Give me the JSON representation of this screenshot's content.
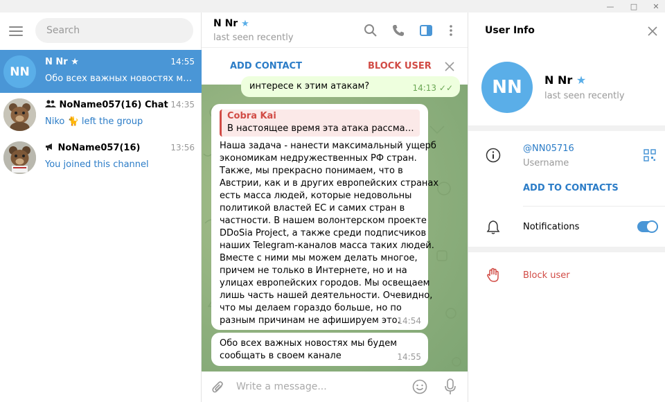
{
  "search": {
    "placeholder": "Search"
  },
  "dialogs": [
    {
      "name": "N Nr",
      "avatar_initials": "NN",
      "time": "14:55",
      "last_message": "Обо всех важных новостях мы б...",
      "starred": true
    },
    {
      "name": "NoName057(16) Chat",
      "time": "14:35",
      "last_message_author": "Niko",
      "last_message": "left the group"
    },
    {
      "name": "NoName057(16)",
      "time": "13:56",
      "last_message": "You joined this channel"
    }
  ],
  "chat": {
    "peer_name": "N Nr",
    "peer_status": "last seen recently",
    "action_bar": {
      "add_contact": "ADD CONTACT",
      "block_user": "BLOCK USER"
    },
    "messages": [
      {
        "direction": "out",
        "text": "интересе к этим атакам?",
        "time": "14:13"
      },
      {
        "direction": "in",
        "quote_author": "Cobra Kai",
        "quote_text": "В настоящее время эта атака рассматрив...",
        "lines": [
          "Наша задача - нанести максимальный ущерб",
          "экономикам недружественных РФ стран.",
          "Также, мы прекрасно понимаем, что в",
          "Австрии, как и в других европейских странах",
          "есть масса людей, которые недовольны",
          "политикой властей ЕС и самих стран в",
          "частности. В нашем волонтерском проекте",
          "DDoSia Project, а также среди подписчиков",
          "наших Telegram-каналов масса таких людей.",
          "Вместе с ними мы можем делать многое,",
          "причем не только в Интернете, но и на",
          "улицах европейских городов. Мы освещаем",
          "лишь часть нашей деятельности. Очевидно,",
          "что мы делаем гораздо больше, но по",
          "разным причинам не афишируем это."
        ],
        "time": "14:54"
      },
      {
        "direction": "in",
        "lines": [
          "Обо всех важных новостях мы будем",
          "сообщать в своем канале"
        ],
        "time": "14:55"
      }
    ],
    "composer_placeholder": "Write a message..."
  },
  "user_info": {
    "title": "User Info",
    "avatar_initials": "NN",
    "name": "N Nr",
    "status": "last seen recently",
    "username": "@NN05716",
    "username_label": "Username",
    "add_to_contacts": "ADD TO CONTACTS",
    "notifications_label": "Notifications",
    "notifications_on": true,
    "block_user": "Block user"
  },
  "colors": {
    "accent": "#4a96d6",
    "link": "#2b7cc7",
    "danger": "#d14b45",
    "chat_background": "#8cae7c"
  }
}
